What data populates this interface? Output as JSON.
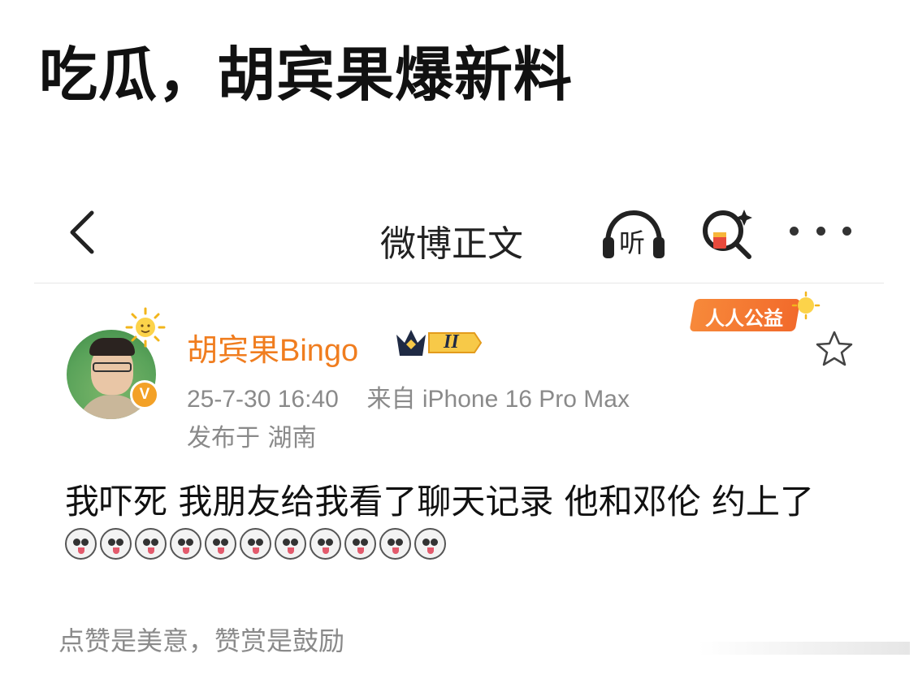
{
  "headline": "吃瓜，胡宾果爆新料",
  "nav": {
    "title": "微博正文",
    "listen_label": "听"
  },
  "post": {
    "username": "胡宾果Bingo",
    "vip_level": "II",
    "timestamp": "25-7-30 16:40",
    "source": "来自 iPhone 16 Pro Max",
    "location": "发布于 湖南",
    "charity_badge": "人人公益",
    "verified_mark": "V",
    "text": "我吓死 我朋友给我看了聊天记录 他和邓伦 约上了",
    "emoji_count": 11,
    "emoji_name": "dog-emoji"
  },
  "footer": {
    "reward_text": "点赞是美意，赞赏是鼓励"
  },
  "colors": {
    "username": "#f07d1f",
    "meta": "#8a8a8a",
    "accent": "#f3a127"
  }
}
